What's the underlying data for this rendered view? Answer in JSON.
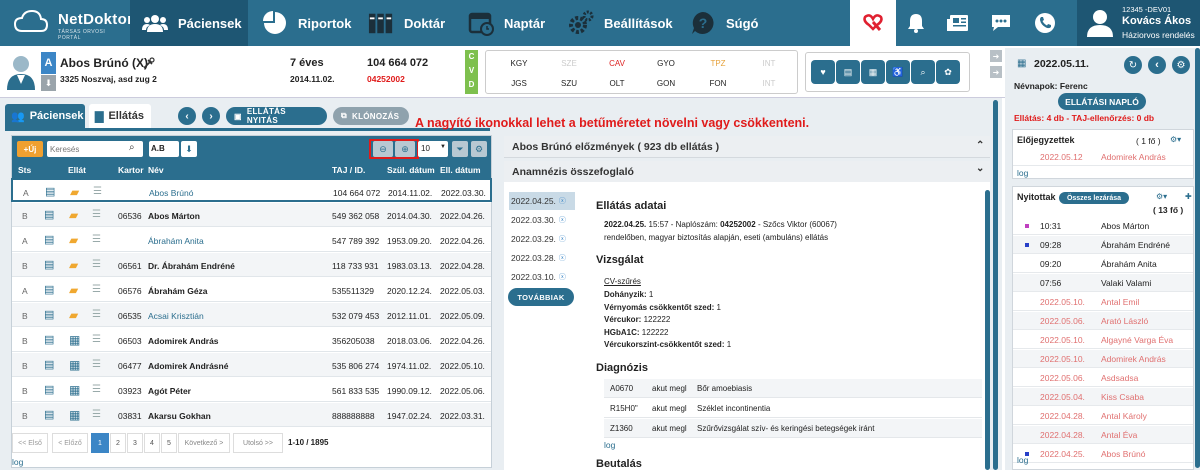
{
  "nav": {
    "logo": "NetDoktor",
    "logo_sub": "TÁRSAS ORVOSI PORTÁL",
    "items": [
      {
        "label": "Páciensek",
        "icon": "users-icon"
      },
      {
        "label": "Riportok",
        "icon": "chart-icon"
      },
      {
        "label": "Doktár",
        "icon": "binders-icon"
      },
      {
        "label": "Naptár",
        "icon": "calendar-icon"
      },
      {
        "label": "Beállítások",
        "icon": "gears-icon"
      },
      {
        "label": "Súgó",
        "icon": "help-icon"
      }
    ],
    "user_code": "12345 -DEV01",
    "user_name": "Kovács Ákos",
    "user_role": "Háziorvos rendelés"
  },
  "patient": {
    "status": "A",
    "name": "Abos Brúnó (X)",
    "address": "3325 Noszvaj, asd zug 2",
    "age": "7 éves",
    "birth": "2014.11.02.",
    "taj": "104 664 072",
    "code": "04252002",
    "cvd": [
      "C",
      "V",
      "D"
    ],
    "codes": [
      {
        "t": "KGY",
        "c": "#222"
      },
      {
        "t": "SZE",
        "c": "#ccc"
      },
      {
        "t": "CAV",
        "c": "#d22"
      },
      {
        "t": "GYO",
        "c": "#222"
      },
      {
        "t": "TPZ",
        "c": "#e6a23c"
      },
      {
        "t": "INT",
        "c": "#ccc"
      },
      {
        "t": "JGS",
        "c": "#222"
      },
      {
        "t": "SZU",
        "c": "#222"
      },
      {
        "t": "OLT",
        "c": "#222"
      },
      {
        "t": "GON",
        "c": "#222"
      },
      {
        "t": "FON",
        "c": "#222"
      },
      {
        "t": "INT",
        "c": "#ccc"
      }
    ]
  },
  "tabs": {
    "patients": "Páciensek",
    "care": "Ellátás"
  },
  "actions": {
    "open_care": "ELLÁTÁS NYITÁS",
    "clone": "KLÓNOZÁS"
  },
  "note": "A nagyító ikonokkal lehet a betűméretet növelni vagy csökkenteni.",
  "table": {
    "new": "+Új",
    "search_placeholder": "Keresés",
    "sort": "A.B",
    "pagesize": "10",
    "cols": [
      "Sts",
      "Ellát",
      "Kartor",
      "Név",
      "TAJ / ID.",
      "Szül. dátum",
      "Ell. dátum"
    ],
    "rows": [
      {
        "sts": "A",
        "kartor": "",
        "name": "Abos Brúnó",
        "taj": "104 664 072",
        "birth": "2014.11.02.",
        "ell": "2022.03.30.",
        "link": true,
        "folder": true
      },
      {
        "sts": "B",
        "kartor": "06536",
        "name": "Abos Márton",
        "taj": "549 362 058",
        "birth": "2014.04.30.",
        "ell": "2022.04.26.",
        "link": false,
        "folder": true
      },
      {
        "sts": "A",
        "kartor": "",
        "name": "Ábrahám Anita",
        "taj": "547 789 392",
        "birth": "1953.09.20.",
        "ell": "2022.04.26.",
        "link": true,
        "folder": true
      },
      {
        "sts": "B",
        "kartor": "06561",
        "name": "Dr. Ábrahám Endréné",
        "taj": "118 733 931",
        "birth": "1983.03.13.",
        "ell": "2022.04.28.",
        "link": false,
        "folder": true
      },
      {
        "sts": "A",
        "kartor": "06576",
        "name": "Ábrahám Géza",
        "taj": "535511329",
        "birth": "2020.12.24.",
        "ell": "2022.05.03.",
        "link": false,
        "folder": true
      },
      {
        "sts": "B",
        "kartor": "06535",
        "name": "Acsai Krisztián",
        "taj": "532 079 453",
        "birth": "2012.11.01.",
        "ell": "2022.05.09.",
        "link": true,
        "folder": true
      },
      {
        "sts": "B",
        "kartor": "06503",
        "name": "Adomirek András",
        "taj": "356205038",
        "birth": "2018.03.06.",
        "ell": "2022.04.26.",
        "link": false,
        "folder": false
      },
      {
        "sts": "B",
        "kartor": "06477",
        "name": "Adomirek Andrásné",
        "taj": "535 806 274",
        "birth": "1974.11.02.",
        "ell": "2022.05.10.",
        "link": false,
        "folder": false
      },
      {
        "sts": "B",
        "kartor": "03923",
        "name": "Agót Péter",
        "taj": "561 833 535",
        "birth": "1990.09.12.",
        "ell": "2022.05.06.",
        "link": false,
        "folder": false
      },
      {
        "sts": "B",
        "kartor": "03831",
        "name": "Akarsu Gokhan",
        "taj": "888888888",
        "birth": "1947.02.24.",
        "ell": "2022.03.31.",
        "link": false,
        "folder": false
      }
    ],
    "pager": {
      "first": "<< Első",
      "prev": "< Előző",
      "pages": [
        "1",
        "2",
        "3",
        "4",
        "5"
      ],
      "next": "Következő >",
      "last": "Utolsó >>",
      "info": "1-10 / 1895"
    },
    "log": "log"
  },
  "history": {
    "title": "Abos Brúnó előzmények ( 923 db ellátás )",
    "anamnesis": "Anamnézis összefoglaló",
    "dates": [
      "2022.04.25.",
      "2022.03.30.",
      "2022.03.29.",
      "2022.03.28.",
      "2022.03.10."
    ],
    "more": "TOVÁBBIAK",
    "care_title": "Ellátás adatai",
    "care_date": "2022.04.25.",
    "care_time": "15:57 - Naplószám:",
    "care_num": "04252002",
    "care_doc": "- Szőcs Viktor (60067)",
    "care_line2": "rendelőben, magyar biztosítás alapján, eseti (ambuláns) ellátás",
    "exam_title": "Vizsgálat",
    "cv": "CV-szűrés",
    "fields": [
      {
        "k": "Dohányzik:",
        "v": "1"
      },
      {
        "k": "Vérnyomás csökkentőt szed:",
        "v": "1"
      },
      {
        "k": "Vércukor:",
        "v": "122222"
      },
      {
        "k": "HGbA1C:",
        "v": "122222"
      },
      {
        "k": "Vércukorszint-csökkentőt szed:",
        "v": "1"
      }
    ],
    "diag_title": "Diagnózis",
    "diags": [
      {
        "c": "A0670",
        "t": "akut megl",
        "d": "Bőr amoebiasis"
      },
      {
        "c": "R15H0\"",
        "t": "akut megl",
        "d": "Széklet incontinentia"
      },
      {
        "c": "Z1360",
        "t": "akut megl",
        "d": "Szűrővizsgálat szív- és keringési betegségek iránt"
      }
    ],
    "log": "log",
    "ref_title": "Beutalás"
  },
  "right": {
    "date": "2022.05.11.",
    "nameday": "Névnapok: Ferenc",
    "diary": "ELLÁTÁSI NAPLÓ",
    "stats": "Ellátás: 4 db - TAJ-ellenőrzés: 0 db",
    "pre_title": "Előjegyzettek",
    "pre_count": "( 1 fő )",
    "pre": [
      {
        "date": "2022.05.12",
        "name": "Adomirek András"
      }
    ],
    "open_title": "Nyitottak",
    "close_all": "Összes lezárása",
    "open_count": "( 13 fő )",
    "open": [
      {
        "t": "10:31",
        "n": "Abos Márton",
        "c": "#222",
        "dot": "#c040c0"
      },
      {
        "t": "09:28",
        "n": "Ábrahám Endréné",
        "c": "#222",
        "dot": "#2840c8"
      },
      {
        "t": "09:20",
        "n": "Ábrahám Anita",
        "c": "#222",
        "dot": ""
      },
      {
        "t": "07:56",
        "n": "Valaki Valami",
        "c": "#222",
        "dot": ""
      },
      {
        "t": "2022.05.10.",
        "n": "Antal Emil",
        "c": "#e07070",
        "dot": ""
      },
      {
        "t": "2022.05.06.",
        "n": "Arató László",
        "c": "#e07070",
        "dot": ""
      },
      {
        "t": "2022.05.10.",
        "n": "Algayné Varga Éva",
        "c": "#e07070",
        "dot": ""
      },
      {
        "t": "2022.05.10.",
        "n": "Adomirek András",
        "c": "#e07070",
        "dot": ""
      },
      {
        "t": "2022.05.06.",
        "n": "Asdsadsa",
        "c": "#e07070",
        "dot": ""
      },
      {
        "t": "2022.05.04.",
        "n": "Kiss Csaba",
        "c": "#e07070",
        "dot": ""
      },
      {
        "t": "2022.04.28.",
        "n": "Antal Károly",
        "c": "#e07070",
        "dot": ""
      },
      {
        "t": "2022.04.28.",
        "n": "Antal Éva",
        "c": "#e07070",
        "dot": ""
      },
      {
        "t": "2022.04.25.",
        "n": "Abos Brúnó",
        "c": "#e07070",
        "dot": "#2840c8"
      }
    ],
    "log": "log"
  }
}
